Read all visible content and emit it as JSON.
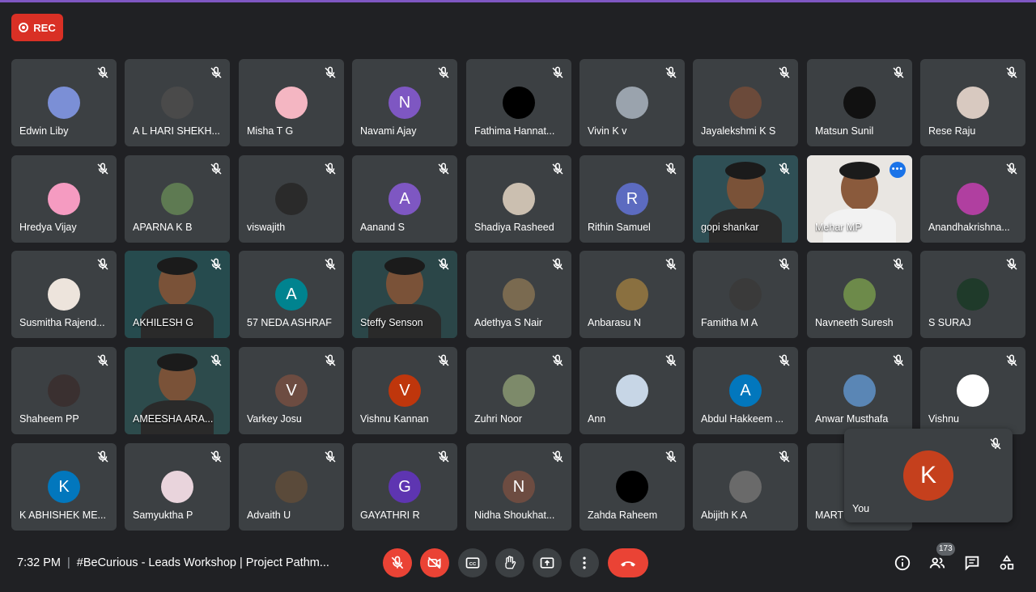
{
  "meeting": {
    "time": "7:32 PM",
    "title": "#BeCurious - Leads Workshop | Project Pathm...",
    "participant_count": "173",
    "rec_label": "REC"
  },
  "self_tile": {
    "name": "You",
    "initial": "K",
    "color": "#c5401d"
  },
  "colors": {
    "accent": "#8ab4f8",
    "danger": "#ea4335",
    "tile": "#3c4043",
    "background": "#202124"
  },
  "participants": [
    {
      "name": "Edwin Liby",
      "type": "photo",
      "color": "#7b8fd6"
    },
    {
      "name": "A L HARI SHEKH...",
      "type": "photo",
      "color": "#4a4a4a"
    },
    {
      "name": "Misha T G",
      "type": "photo",
      "color": "#f4b6c2"
    },
    {
      "name": "Navami Ajay",
      "type": "initial",
      "initial": "N",
      "color": "#7e57c2"
    },
    {
      "name": "Fathima Hannat...",
      "type": "photo",
      "color": "#000000"
    },
    {
      "name": "Vivin K v",
      "type": "photo",
      "color": "#9aa3ad"
    },
    {
      "name": "Jayalekshmi K S",
      "type": "photo",
      "color": "#6b4a3a"
    },
    {
      "name": "Matsun Sunil",
      "type": "photo",
      "color": "#111111"
    },
    {
      "name": "Rese Raju",
      "type": "photo",
      "color": "#d8c9c0"
    },
    {
      "name": "Hredya Vijay",
      "type": "photo",
      "color": "#f59bc1"
    },
    {
      "name": "APARNA K B",
      "type": "photo",
      "color": "#5e7a52"
    },
    {
      "name": "viswajith",
      "type": "photo",
      "color": "#2a2a2a"
    },
    {
      "name": "Aanand S",
      "type": "initial",
      "initial": "A",
      "color": "#7e57c2"
    },
    {
      "name": "Shadiya Rasheed",
      "type": "photo",
      "color": "#cbbfb0"
    },
    {
      "name": "Rithin Samuel",
      "type": "initial",
      "initial": "R",
      "color": "#5c6bc0"
    },
    {
      "name": "gopi shankar",
      "type": "video",
      "color": "#2f4f55"
    },
    {
      "name": "Mehar MP",
      "type": "video",
      "color": "#e9e6e2",
      "speaking": true
    },
    {
      "name": "Anandhakrishna...",
      "type": "photo",
      "color": "#b03fa0"
    },
    {
      "name": "Susmitha Rajend...",
      "type": "photo",
      "color": "#ede4dc"
    },
    {
      "name": "AKHILESH G",
      "type": "video",
      "color": "#264b4e"
    },
    {
      "name": "57 NEDA ASHRAF",
      "type": "initial",
      "initial": "A",
      "color": "#00838f"
    },
    {
      "name": "Steffy Senson",
      "type": "video",
      "color": "#2b4648"
    },
    {
      "name": "Adethya S Nair",
      "type": "photo",
      "color": "#7a6a50"
    },
    {
      "name": "Anbarasu N",
      "type": "photo",
      "color": "#8a7040"
    },
    {
      "name": "Famitha M A",
      "type": "photo",
      "color": "#3a3a3a"
    },
    {
      "name": "Navneeth Suresh",
      "type": "photo",
      "color": "#6d8a4a"
    },
    {
      "name": "S SURAJ",
      "type": "photo",
      "color": "#1f3a2a"
    },
    {
      "name": "Shaheem PP",
      "type": "photo",
      "color": "#3a3030"
    },
    {
      "name": "AMEESHA ARA...",
      "type": "video",
      "color": "#2d4b4c"
    },
    {
      "name": "Varkey Josu",
      "type": "initial",
      "initial": "V",
      "color": "#6d4c41"
    },
    {
      "name": "Vishnu Kannan",
      "type": "initial",
      "initial": "V",
      "color": "#bf360c"
    },
    {
      "name": "Zuhri Noor",
      "type": "photo",
      "color": "#7d8a6a"
    },
    {
      "name": "Ann",
      "type": "photo",
      "color": "#c7d6e6"
    },
    {
      "name": "Abdul Hakkeem ...",
      "type": "initial",
      "initial": "A",
      "color": "#0277bd"
    },
    {
      "name": "Anwar Musthafa",
      "type": "photo",
      "color": "#5a86b5"
    },
    {
      "name": "Vishnu",
      "type": "photo",
      "color": "#ffffff"
    },
    {
      "name": "K ABHISHEK ME...",
      "type": "initial",
      "initial": "K",
      "color": "#0277bd"
    },
    {
      "name": "Samyuktha P",
      "type": "photo",
      "color": "#e9d4dc"
    },
    {
      "name": "Advaith U",
      "type": "photo",
      "color": "#5a4a3a"
    },
    {
      "name": "GAYATHRI R",
      "type": "initial",
      "initial": "G",
      "color": "#5e35b1"
    },
    {
      "name": "Nidha Shoukhat...",
      "type": "initial",
      "initial": "N",
      "color": "#6d4c41"
    },
    {
      "name": "Zahda Raheem",
      "type": "photo",
      "color": "#000000"
    },
    {
      "name": "Abijith K A",
      "type": "photo",
      "color": "#6a6a6a"
    },
    {
      "name": "MART",
      "type": "photo",
      "color": "#3c4043"
    }
  ]
}
